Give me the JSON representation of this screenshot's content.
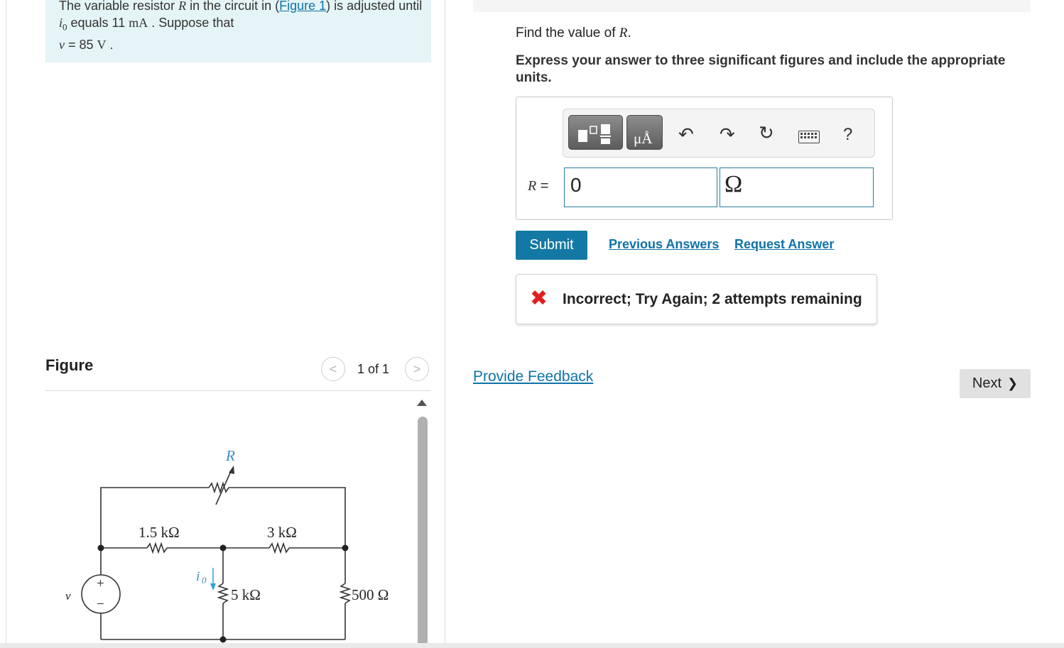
{
  "problem": {
    "part1": "The variable resistor ",
    "var_r": "R",
    "part2": " in the circuit in (",
    "figure_link": "Figure 1",
    "part3": ") is adjusted until ",
    "var_io": "i",
    "io_sub": "0",
    "part4": " equals 11  ",
    "unit_ma": "mA",
    "part5": " . Suppose that ",
    "var_v": "v",
    "part6": " = 85  ",
    "unit_v": "V",
    "part7": " ."
  },
  "figure": {
    "title": "Figure",
    "count": "1 of 1",
    "prev_glyph": "<",
    "next_glyph": ">",
    "circuit": {
      "label_r": "R",
      "label_r1": "1.5 kΩ",
      "label_r2": "3 kΩ",
      "label_r3": "5 kΩ",
      "label_r4": "500 Ω",
      "label_v": "v",
      "label_io": "i",
      "label_io_sub": "0",
      "plus": "+",
      "minus": "−"
    }
  },
  "question": {
    "prefix": "Find the value of ",
    "var": "R",
    "suffix": "."
  },
  "instructions": "Express your answer to three significant figures and include the appropriate units.",
  "toolbar": {
    "units_glyph": "μÅ",
    "undo_glyph": "↶",
    "redo_glyph": "↷",
    "reset_glyph": "↻",
    "help_glyph": "?"
  },
  "answer": {
    "label_var": "R",
    "label_eq": " =",
    "value": "0",
    "unit": "Ω"
  },
  "submit_label": "Submit",
  "previous_answers": "Previous Answers",
  "request_answer": "Request Answer",
  "feedback": {
    "icon": "✖",
    "text": "Incorrect; Try Again; 2 attempts remaining"
  },
  "provide_feedback": "Provide Feedback",
  "next_label": "Next",
  "next_glyph": "❯"
}
